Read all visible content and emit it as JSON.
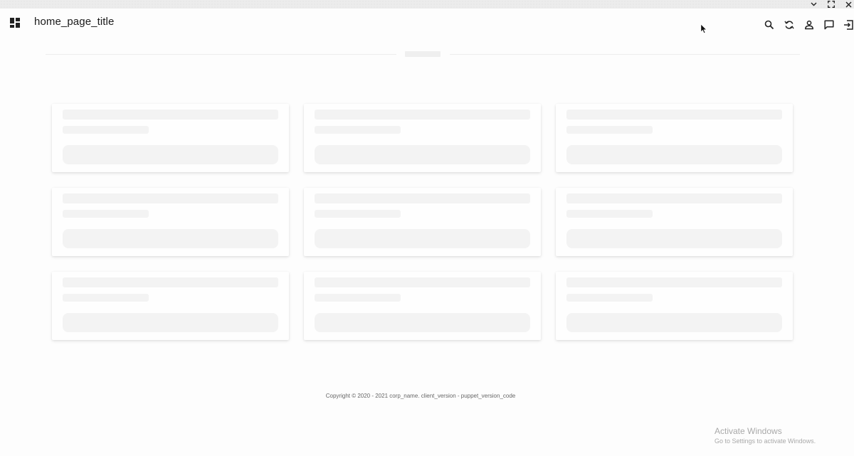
{
  "header": {
    "title": "home_page_title",
    "icons": [
      "dashboard-icon",
      "search-icon",
      "refresh-icon",
      "user-icon",
      "chat-icon",
      "logout-icon"
    ]
  },
  "window_controls": [
    "chevron-down-icon",
    "fullscreen-icon",
    "close-icon"
  ],
  "main": {
    "state": "loading",
    "card_count": 9
  },
  "footer": {
    "text": "Copyright © 2020 - 2021 corp_name. client_version - puppet_version_code"
  },
  "watermark": {
    "line1": "Activate Windows",
    "line2": "Go to Settings to activate Windows."
  }
}
